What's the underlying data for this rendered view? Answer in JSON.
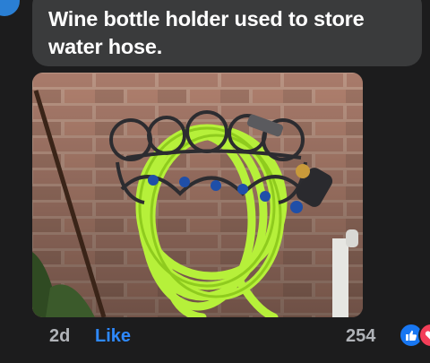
{
  "comment": {
    "text_line1": "Wine bottle holder used to store",
    "text_line2": "water hose."
  },
  "meta": {
    "timestamp": "2d",
    "like_label": "Like",
    "reaction_count": "254"
  },
  "icons": {
    "like": "thumbs-up-icon",
    "love": "heart-icon"
  },
  "colors": {
    "background": "#1c1c1d",
    "bubble": "#3a3b3c",
    "like_blue": "#2e89ff",
    "love_red": "#f33e58",
    "hose_green": "#b6f03a"
  }
}
